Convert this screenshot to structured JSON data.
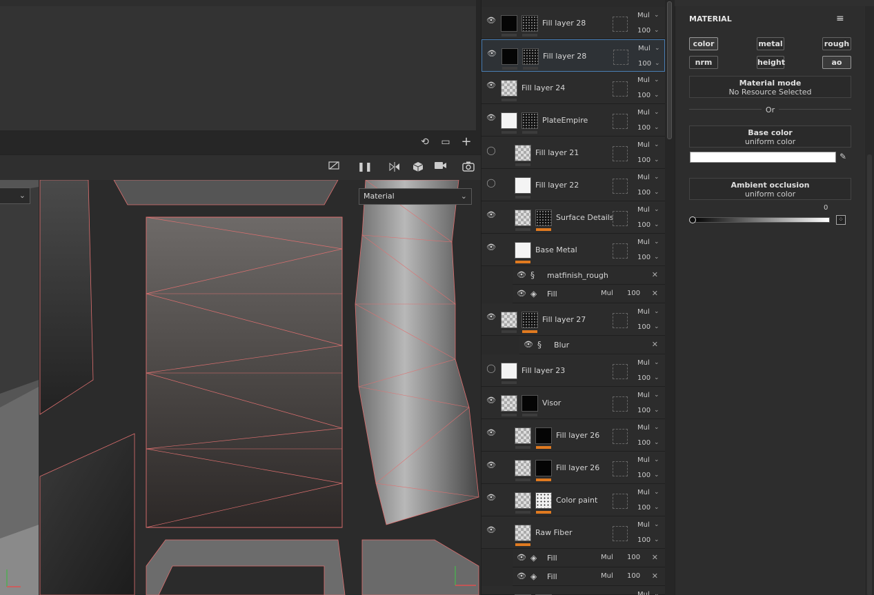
{
  "top_toolbar": {
    "reset_icon": "reset-icon",
    "window_icon": "window-icon",
    "plus_icon": "plus-icon"
  },
  "viewport_toolbar": {
    "icons": [
      "hide-icon",
      "pause-icon",
      "symmetry-icon",
      "cube-icon",
      "camera-icon",
      "screenshot-icon"
    ]
  },
  "viewport": {
    "material_dropdown": "Material"
  },
  "layers": [
    {
      "name": "Fill layer 28",
      "visible": true,
      "blend": "Mul",
      "opacity": "100"
    },
    {
      "name": "Fill layer 28",
      "visible": true,
      "blend": "Mul",
      "opacity": "100",
      "selected": true
    },
    {
      "name": "Fill layer 24",
      "visible": true,
      "blend": "Mul",
      "opacity": "100"
    },
    {
      "name": "PlateEmpire",
      "visible": true,
      "blend": "Mul",
      "opacity": "100",
      "folder": true
    },
    {
      "name": "Fill layer 21",
      "visible": false,
      "blend": "Mul",
      "opacity": "100"
    },
    {
      "name": "Fill layer 22",
      "visible": false,
      "blend": "Mul",
      "opacity": "100"
    },
    {
      "name": "Surface Details",
      "visible": true,
      "blend": "Mul",
      "opacity": "100"
    },
    {
      "name": "Base Metal",
      "visible": true,
      "blend": "Mul",
      "opacity": "100"
    },
    {
      "name": "Fill layer 27",
      "visible": true,
      "blend": "Mul",
      "opacity": "100"
    },
    {
      "name": "Fill layer 23",
      "visible": false,
      "blend": "Mul",
      "opacity": "100"
    },
    {
      "name": "Visor",
      "visible": true,
      "blend": "Mul",
      "opacity": "100",
      "folder": true
    },
    {
      "name": "Fill layer 26",
      "visible": true,
      "blend": "Mul",
      "opacity": "100"
    },
    {
      "name": "Fill layer 26",
      "visible": true,
      "blend": "Mul",
      "opacity": "100"
    },
    {
      "name": "Color paint",
      "visible": true,
      "blend": "Mul",
      "opacity": "100"
    },
    {
      "name": "Raw Fiber",
      "visible": true,
      "blend": "Mul",
      "opacity": "100"
    },
    {
      "name": "",
      "visible": true,
      "blend": "Mul",
      "opacity": ""
    }
  ],
  "effects": {
    "base_metal": [
      {
        "name": "matfinish_rough",
        "icon": "substance-icon"
      },
      {
        "name": "Fill",
        "icon": "fill-icon",
        "blend": "Mul",
        "opacity": "100"
      }
    ],
    "fill27": [
      {
        "name": "Blur",
        "icon": "substance-icon"
      }
    ],
    "raw_fiber": [
      {
        "name": "Fill",
        "icon": "fill-icon",
        "blend": "Mul",
        "opacity": "100"
      },
      {
        "name": "Fill",
        "icon": "fill-icon",
        "blend": "Mul",
        "opacity": "100"
      }
    ]
  },
  "properties": {
    "title": "MATERIAL",
    "channels": [
      "color",
      "metal",
      "rough",
      "nrm",
      "height",
      "ao"
    ],
    "channels_on": [
      "color",
      "ao"
    ],
    "material_mode": {
      "title": "Material mode",
      "value": "No Resource Selected"
    },
    "or_label": "Or",
    "base_color": {
      "title": "Base color",
      "value": "uniform color",
      "swatch": "#ffffff"
    },
    "ambient_occlusion": {
      "title": "Ambient occlusion",
      "value": "uniform color",
      "slider_value": "0"
    }
  }
}
